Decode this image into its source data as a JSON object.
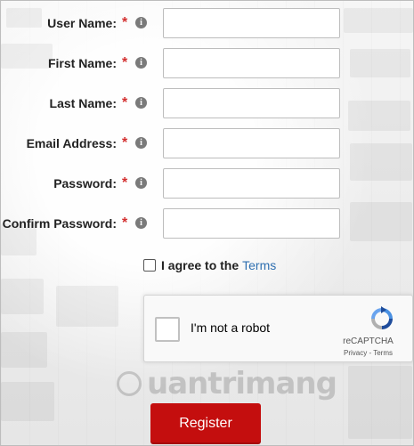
{
  "form": {
    "fields": [
      {
        "label": "User Name:",
        "required_mark": "*",
        "info_icon": "i",
        "value": "",
        "placeholder": ""
      },
      {
        "label": "First Name:",
        "required_mark": "*",
        "info_icon": "i",
        "value": "",
        "placeholder": ""
      },
      {
        "label": "Last Name:",
        "required_mark": "*",
        "info_icon": "i",
        "value": "",
        "placeholder": ""
      },
      {
        "label": "Email Address:",
        "required_mark": "*",
        "info_icon": "i",
        "value": "",
        "placeholder": ""
      },
      {
        "label": "Password:",
        "required_mark": "*",
        "info_icon": "i",
        "value": "",
        "placeholder": ""
      },
      {
        "label": "Confirm Password:",
        "required_mark": "*",
        "info_icon": "i",
        "value": "",
        "placeholder": ""
      }
    ],
    "agree": {
      "text": "I agree to the",
      "link_text": "Terms",
      "checked": false
    },
    "recaptcha": {
      "label": "I'm not a robot",
      "brand": "reCAPTCHA",
      "links": "Privacy - Terms"
    },
    "submit_label": "Register"
  },
  "watermark": {
    "text": "uantrimang"
  },
  "colors": {
    "required_star": "#d32f2f",
    "link": "#2e6fb0",
    "register_button": "#c40e0e"
  }
}
